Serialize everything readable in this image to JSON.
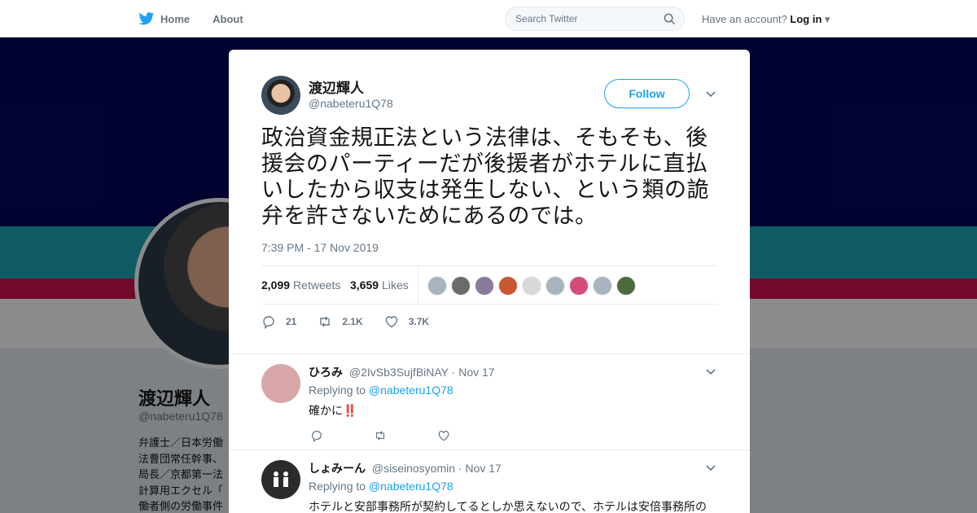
{
  "topbar": {
    "home_label": "Home",
    "about_label": "About",
    "search_placeholder": "Search Twitter",
    "account_prompt": "Have an account?",
    "login_label": "Log in"
  },
  "profile": {
    "name": "渡辺輝人",
    "handle": "@nabeteru1Q78",
    "bio": "弁護士／日本労働\n法曹団常任幹事、\n局長／京都第一法\n計算用エクセル「\n働者側の労働事件"
  },
  "tweet": {
    "author_name": "渡辺輝人",
    "author_handle": "@nabeteru1Q78",
    "follow_label": "Follow",
    "text": "政治資金規正法という法律は、そもそも、後援会のパーティーだが後援者がホテルに直払いしたから収支は発生しない、という類の詭弁を許さないためにあるのでは。",
    "timestamp": "7:39 PM - 17 Nov 2019",
    "retweets_count": "2,099",
    "retweets_label": "Retweets",
    "likes_count": "3,659",
    "likes_label": "Likes",
    "replies_short": "21",
    "retweets_short": "2.1K",
    "likes_short": "3.7K"
  },
  "likers": [
    {
      "color": "#a9b4be"
    },
    {
      "color": "#6b6b6b"
    },
    {
      "color": "#8a7a9b"
    },
    {
      "color": "#c9572f"
    },
    {
      "color": "#d8d8d8"
    },
    {
      "color": "#a9b4be"
    },
    {
      "color": "#d64b7a"
    },
    {
      "color": "#a9b4be"
    },
    {
      "color": "#4d6a3c"
    }
  ],
  "replies": [
    {
      "name": "ひろみ",
      "handle": "@2IvSb3SujfBiNAY",
      "date": "· Nov 17",
      "replying_prefix": "Replying to",
      "replying_to": "@nabeteru1Q78",
      "text": "確かに",
      "emoji": "‼️",
      "avatar_color": "#d9a7a8"
    },
    {
      "name": "しょみーん",
      "handle": "@siseinosyomin",
      "date": "· Nov 17",
      "replying_prefix": "Replying to",
      "replying_to": "@nabeteru1Q78",
      "text": "ホテルと安部事務所が契約してるとしか思えないので、ホテルは安倍事務所の",
      "avatar_color": "#2b2b2b"
    }
  ],
  "colors": {
    "accent": "#1da1f2",
    "banner_top": "#030558",
    "banner_mid": "#1ea7b4",
    "banner_bottom": "#d1114f"
  }
}
